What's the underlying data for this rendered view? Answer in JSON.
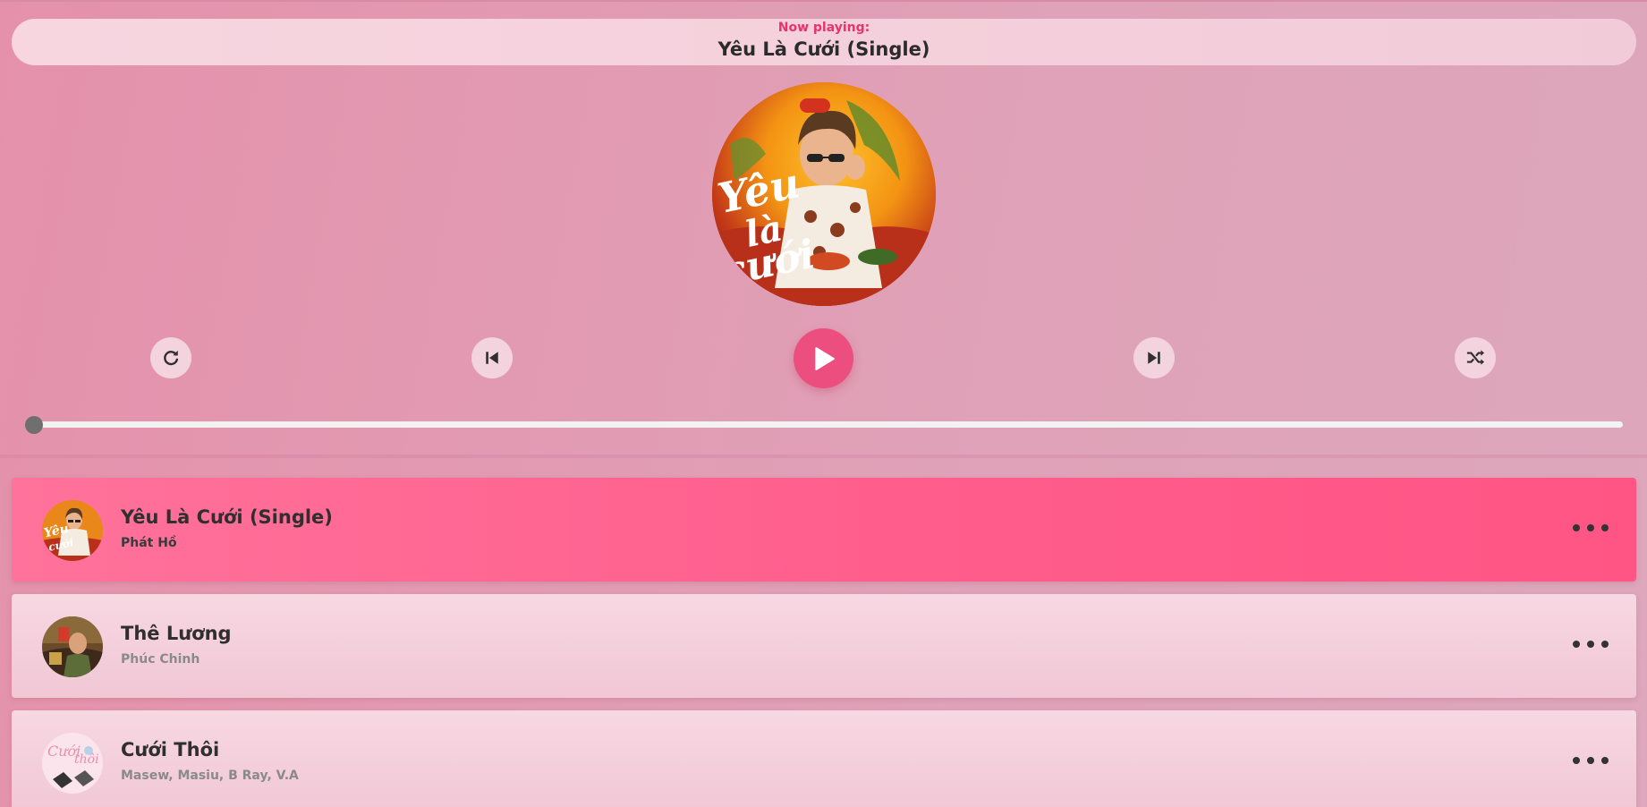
{
  "now_playing": {
    "label": "Now playing:",
    "title": "Yêu Là Cưới (Single)"
  },
  "cover": {
    "alt_icon": "album-cover-art"
  },
  "controls": {
    "repeat_icon": "repeat-icon",
    "prev_icon": "skip-previous-icon",
    "play_icon": "play-icon",
    "next_icon": "skip-next-icon",
    "shuffle_icon": "shuffle-icon"
  },
  "progress": {
    "value": 0
  },
  "playlist": [
    {
      "title": "Yêu Là Cưới (Single)",
      "artist": "Phát Hồ",
      "active": true
    },
    {
      "title": "Thê Lương",
      "artist": "Phúc Chinh",
      "active": false
    },
    {
      "title": "Cưới Thôi",
      "artist": "Masew, Masiu, B Ray, V.A",
      "active": false
    }
  ],
  "colors": {
    "accent": "#ec4f7f",
    "now_label": "#e8336d",
    "active_song": "#ff5c8b",
    "background": "#e591ab"
  }
}
